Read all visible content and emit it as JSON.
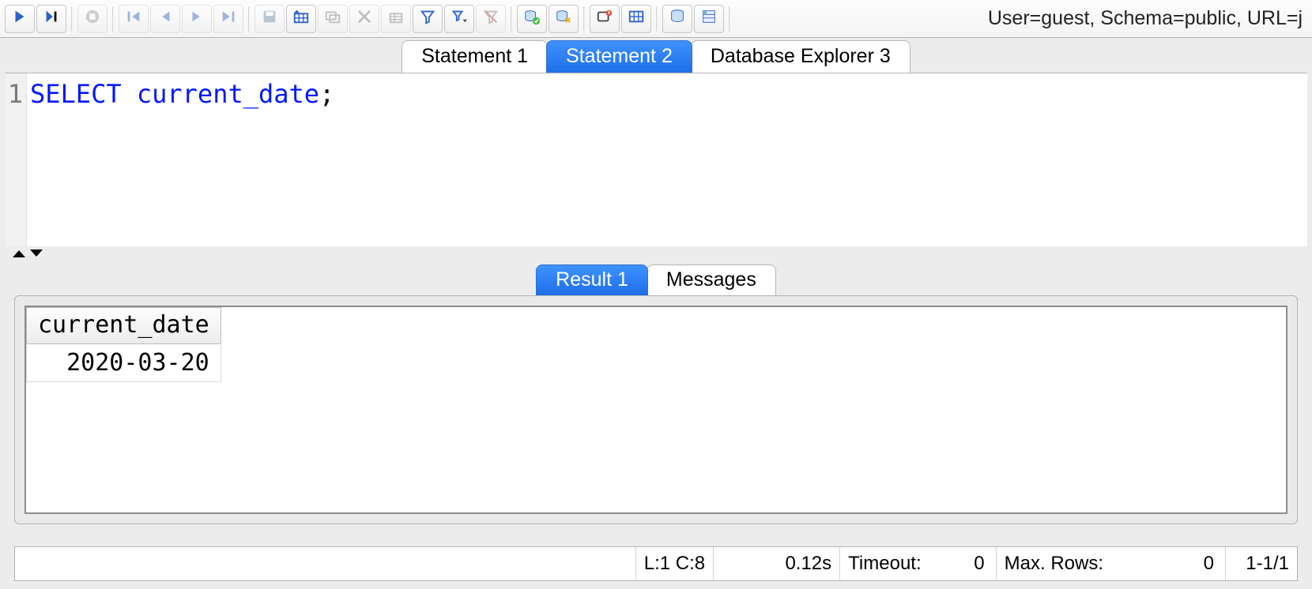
{
  "connection_info": "User=guest, Schema=public, URL=j",
  "editor_tabs": [
    {
      "label": "Statement 1",
      "active": false
    },
    {
      "label": "Statement 2",
      "active": true
    },
    {
      "label": "Database Explorer 3",
      "active": false
    }
  ],
  "editor": {
    "line_numbers": [
      "1"
    ],
    "code": {
      "keyword": "SELECT",
      "identifier": "current_date",
      "terminator": ";"
    }
  },
  "result_tabs": [
    {
      "label": "Result 1",
      "active": true
    },
    {
      "label": "Messages",
      "active": false
    }
  ],
  "result": {
    "columns": [
      "current_date"
    ],
    "rows": [
      [
        "2020-03-20"
      ]
    ]
  },
  "status": {
    "cursor": "L:1 C:8",
    "exec_time": "0.12s",
    "timeout_label": "Timeout:",
    "timeout": "0",
    "maxrows_label": "Max. Rows:",
    "maxrows": "0",
    "row_range": "1-1/1"
  },
  "toolbar": {
    "run": "run-icon",
    "run_cursor": "run-to-cursor-icon",
    "stop": "stop-icon",
    "first": "first-record-icon",
    "prev": "prev-record-icon",
    "next": "next-record-icon",
    "last": "last-record-icon",
    "save": "save-icon",
    "insert_row": "insert-row-icon",
    "copy_row": "copy-row-icon",
    "delete_row": "delete-row-icon",
    "lock": "edit-lock-icon",
    "filter": "filter-icon",
    "clear_filter": "clear-filter-icon",
    "db_commit": "db-commit-icon",
    "db_rollback": "db-rollback-icon",
    "autocommit": "autocommit-icon",
    "columns": "select-columns-icon",
    "new_db": "db-icon",
    "properties": "properties-icon"
  }
}
